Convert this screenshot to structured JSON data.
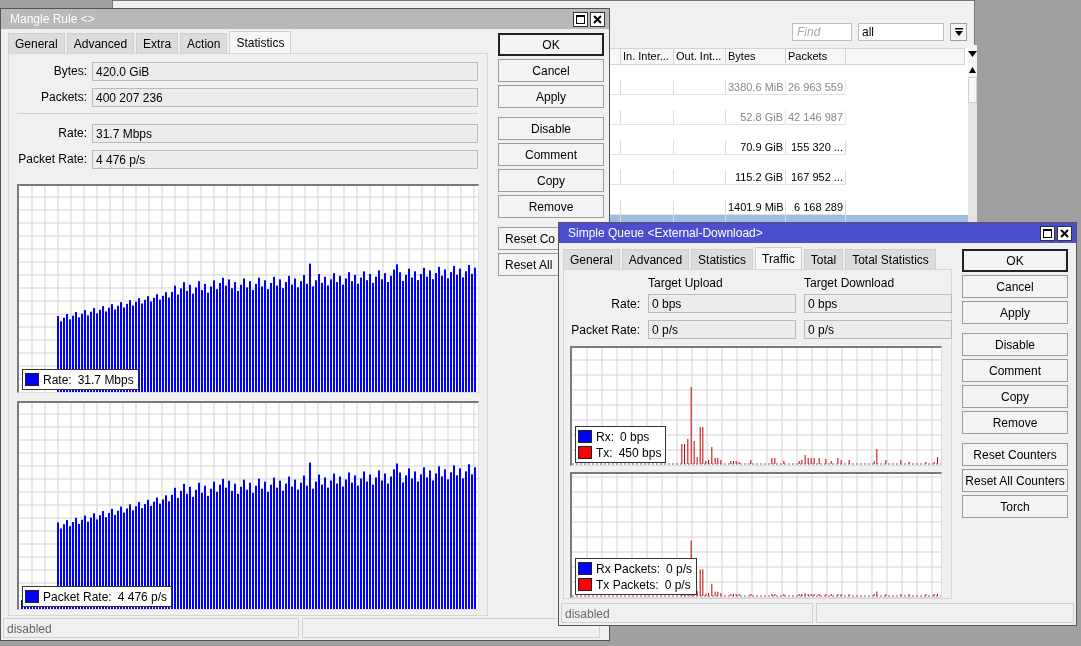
{
  "background_window": {
    "find": {
      "placeholder": "Find"
    },
    "filter": {
      "value": "all"
    },
    "table": {
      "columns": [
        "In. Inter...",
        "Out. Int...",
        "Bytes",
        "Packets"
      ],
      "rows": [
        {
          "bytes": "3380.6 MiB",
          "packets": "26 963 559",
          "disabled": true,
          "selected": false
        },
        {
          "bytes": "52.8 GiB",
          "packets": "42 146 987",
          "disabled": true,
          "selected": false
        },
        {
          "bytes": "70.9 GiB",
          "packets": "155 320 ...",
          "disabled": false,
          "selected": false
        },
        {
          "bytes": "115.2 GiB",
          "packets": "167 952 ...",
          "disabled": false,
          "selected": false
        },
        {
          "bytes": "1401.9 MiB",
          "packets": "6 168 289",
          "disabled": false,
          "selected": false
        },
        {
          "disabled": false,
          "selected": true
        }
      ]
    }
  },
  "mangle_window": {
    "title": "Mangle Rule <>",
    "active": false,
    "tabs": [
      {
        "label": "General",
        "selected": false
      },
      {
        "label": "Advanced",
        "selected": false
      },
      {
        "label": "Extra",
        "selected": false
      },
      {
        "label": "Action",
        "selected": false
      },
      {
        "label": "Statistics",
        "selected": true
      }
    ],
    "field_groups": [
      [
        {
          "label": "Bytes:",
          "value": "420.0 GiB"
        },
        {
          "label": "Packets:",
          "value": "400 207 236"
        }
      ],
      [
        {
          "label": "Rate:",
          "value": "31.7 Mbps"
        },
        {
          "label": "Packet Rate:",
          "value": "4 476 p/s"
        }
      ]
    ],
    "graphs": [
      {
        "legend": [
          {
            "label": "Rate:",
            "value": "31.7 Mbps",
            "color": "#0000ff"
          }
        ]
      },
      {
        "legend": [
          {
            "label": "Packet Rate:",
            "value": "4 476 p/s",
            "color": "#0000ff"
          }
        ]
      }
    ],
    "button_groups": [
      [
        {
          "label": "OK",
          "focused": true
        },
        {
          "label": "Cancel",
          "focused": false
        },
        {
          "label": "Apply",
          "focused": false
        }
      ],
      [
        {
          "label": "Disable",
          "focused": false
        },
        {
          "label": "Comment",
          "focused": false
        },
        {
          "label": "Copy",
          "focused": false
        },
        {
          "label": "Remove",
          "focused": false
        }
      ],
      [
        {
          "label": "Reset Co",
          "focused": false
        },
        {
          "label": "Reset All",
          "focused": false
        }
      ]
    ],
    "status": "disabled"
  },
  "simple_queue_window": {
    "title": "Simple Queue <External-Download>",
    "active": true,
    "tabs": [
      {
        "label": "General",
        "selected": false
      },
      {
        "label": "Advanced",
        "selected": false
      },
      {
        "label": "Statistics",
        "selected": false
      },
      {
        "label": "Traffic",
        "selected": true
      },
      {
        "label": "Total",
        "selected": false
      },
      {
        "label": "Total Statistics",
        "selected": false
      }
    ],
    "columns": [
      "Target Upload",
      "Target Download"
    ],
    "rows": [
      {
        "label": "Rate:",
        "values": [
          "0 bps",
          "0 bps"
        ]
      },
      {
        "label": "Packet Rate:",
        "values": [
          "0 p/s",
          "0 p/s"
        ]
      }
    ],
    "graphs": [
      {
        "legend": [
          {
            "label": "Rx:",
            "value": "0 bps",
            "color": "#0000ff"
          },
          {
            "label": "Tx:",
            "value": "450 bps",
            "color": "#ff0000"
          }
        ]
      },
      {
        "legend": [
          {
            "label": "Rx Packets:",
            "value": "0 p/s",
            "color": "#0000ff"
          },
          {
            "label": "Tx Packets:",
            "value": "0 p/s",
            "color": "#ff0000"
          }
        ]
      }
    ],
    "button_groups": [
      [
        {
          "label": "OK",
          "focused": true
        },
        {
          "label": "Cancel",
          "focused": false
        },
        {
          "label": "Apply",
          "focused": false
        }
      ],
      [
        {
          "label": "Disable",
          "focused": false
        },
        {
          "label": "Comment",
          "focused": false
        },
        {
          "label": "Copy",
          "focused": false
        },
        {
          "label": "Remove",
          "focused": false
        }
      ],
      [
        {
          "label": "Reset Counters",
          "focused": false
        },
        {
          "label": "Reset All Counters",
          "focused": false
        },
        {
          "label": "Torch",
          "focused": false
        }
      ]
    ],
    "status": "disabled"
  }
}
